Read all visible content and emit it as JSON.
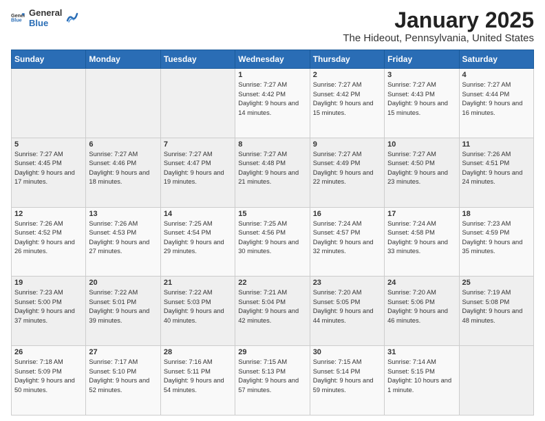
{
  "header": {
    "logo_general": "General",
    "logo_blue": "Blue",
    "month": "January 2025",
    "location": "The Hideout, Pennsylvania, United States"
  },
  "weekdays": [
    "Sunday",
    "Monday",
    "Tuesday",
    "Wednesday",
    "Thursday",
    "Friday",
    "Saturday"
  ],
  "weeks": [
    [
      {
        "day": "",
        "info": ""
      },
      {
        "day": "",
        "info": ""
      },
      {
        "day": "",
        "info": ""
      },
      {
        "day": "1",
        "info": "Sunrise: 7:27 AM\nSunset: 4:42 PM\nDaylight: 9 hours\nand 14 minutes."
      },
      {
        "day": "2",
        "info": "Sunrise: 7:27 AM\nSunset: 4:42 PM\nDaylight: 9 hours\nand 15 minutes."
      },
      {
        "day": "3",
        "info": "Sunrise: 7:27 AM\nSunset: 4:43 PM\nDaylight: 9 hours\nand 15 minutes."
      },
      {
        "day": "4",
        "info": "Sunrise: 7:27 AM\nSunset: 4:44 PM\nDaylight: 9 hours\nand 16 minutes."
      }
    ],
    [
      {
        "day": "5",
        "info": "Sunrise: 7:27 AM\nSunset: 4:45 PM\nDaylight: 9 hours\nand 17 minutes."
      },
      {
        "day": "6",
        "info": "Sunrise: 7:27 AM\nSunset: 4:46 PM\nDaylight: 9 hours\nand 18 minutes."
      },
      {
        "day": "7",
        "info": "Sunrise: 7:27 AM\nSunset: 4:47 PM\nDaylight: 9 hours\nand 19 minutes."
      },
      {
        "day": "8",
        "info": "Sunrise: 7:27 AM\nSunset: 4:48 PM\nDaylight: 9 hours\nand 21 minutes."
      },
      {
        "day": "9",
        "info": "Sunrise: 7:27 AM\nSunset: 4:49 PM\nDaylight: 9 hours\nand 22 minutes."
      },
      {
        "day": "10",
        "info": "Sunrise: 7:27 AM\nSunset: 4:50 PM\nDaylight: 9 hours\nand 23 minutes."
      },
      {
        "day": "11",
        "info": "Sunrise: 7:26 AM\nSunset: 4:51 PM\nDaylight: 9 hours\nand 24 minutes."
      }
    ],
    [
      {
        "day": "12",
        "info": "Sunrise: 7:26 AM\nSunset: 4:52 PM\nDaylight: 9 hours\nand 26 minutes."
      },
      {
        "day": "13",
        "info": "Sunrise: 7:26 AM\nSunset: 4:53 PM\nDaylight: 9 hours\nand 27 minutes."
      },
      {
        "day": "14",
        "info": "Sunrise: 7:25 AM\nSunset: 4:54 PM\nDaylight: 9 hours\nand 29 minutes."
      },
      {
        "day": "15",
        "info": "Sunrise: 7:25 AM\nSunset: 4:56 PM\nDaylight: 9 hours\nand 30 minutes."
      },
      {
        "day": "16",
        "info": "Sunrise: 7:24 AM\nSunset: 4:57 PM\nDaylight: 9 hours\nand 32 minutes."
      },
      {
        "day": "17",
        "info": "Sunrise: 7:24 AM\nSunset: 4:58 PM\nDaylight: 9 hours\nand 33 minutes."
      },
      {
        "day": "18",
        "info": "Sunrise: 7:23 AM\nSunset: 4:59 PM\nDaylight: 9 hours\nand 35 minutes."
      }
    ],
    [
      {
        "day": "19",
        "info": "Sunrise: 7:23 AM\nSunset: 5:00 PM\nDaylight: 9 hours\nand 37 minutes."
      },
      {
        "day": "20",
        "info": "Sunrise: 7:22 AM\nSunset: 5:01 PM\nDaylight: 9 hours\nand 39 minutes."
      },
      {
        "day": "21",
        "info": "Sunrise: 7:22 AM\nSunset: 5:03 PM\nDaylight: 9 hours\nand 40 minutes."
      },
      {
        "day": "22",
        "info": "Sunrise: 7:21 AM\nSunset: 5:04 PM\nDaylight: 9 hours\nand 42 minutes."
      },
      {
        "day": "23",
        "info": "Sunrise: 7:20 AM\nSunset: 5:05 PM\nDaylight: 9 hours\nand 44 minutes."
      },
      {
        "day": "24",
        "info": "Sunrise: 7:20 AM\nSunset: 5:06 PM\nDaylight: 9 hours\nand 46 minutes."
      },
      {
        "day": "25",
        "info": "Sunrise: 7:19 AM\nSunset: 5:08 PM\nDaylight: 9 hours\nand 48 minutes."
      }
    ],
    [
      {
        "day": "26",
        "info": "Sunrise: 7:18 AM\nSunset: 5:09 PM\nDaylight: 9 hours\nand 50 minutes."
      },
      {
        "day": "27",
        "info": "Sunrise: 7:17 AM\nSunset: 5:10 PM\nDaylight: 9 hours\nand 52 minutes."
      },
      {
        "day": "28",
        "info": "Sunrise: 7:16 AM\nSunset: 5:11 PM\nDaylight: 9 hours\nand 54 minutes."
      },
      {
        "day": "29",
        "info": "Sunrise: 7:15 AM\nSunset: 5:13 PM\nDaylight: 9 hours\nand 57 minutes."
      },
      {
        "day": "30",
        "info": "Sunrise: 7:15 AM\nSunset: 5:14 PM\nDaylight: 9 hours\nand 59 minutes."
      },
      {
        "day": "31",
        "info": "Sunrise: 7:14 AM\nSunset: 5:15 PM\nDaylight: 10 hours\nand 1 minute."
      },
      {
        "day": "",
        "info": ""
      }
    ]
  ]
}
